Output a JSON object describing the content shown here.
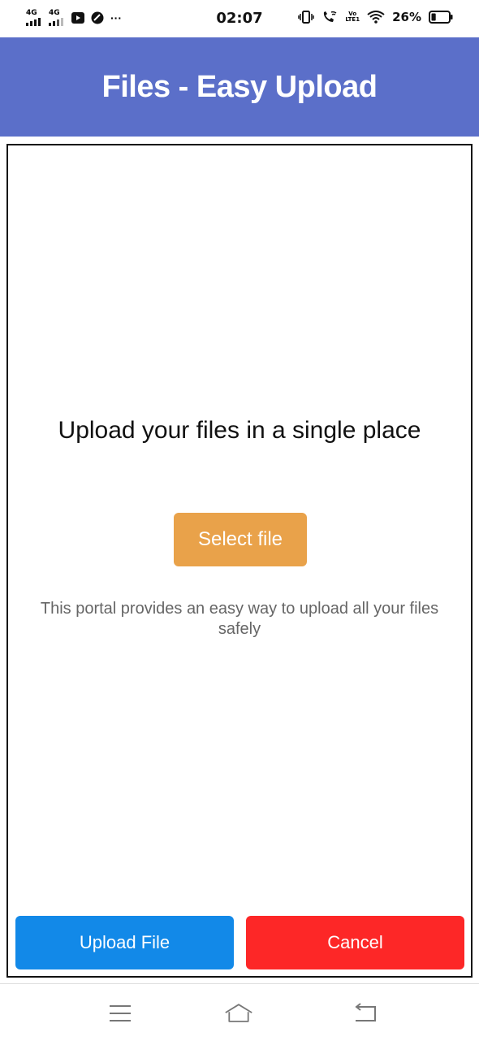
{
  "status_bar": {
    "network1": "4G",
    "network2": "4G",
    "volte_line1": "Vo",
    "volte_line2": "LTE1",
    "more": "···",
    "time": "02:07",
    "battery_percent": "26%",
    "battery_level": 0.26
  },
  "header": {
    "title": "Files - Easy Upload",
    "background_color": "#5b6fc9"
  },
  "main": {
    "headline": "Upload your files in a single place",
    "select_button": "Select file",
    "description": "This portal provides an easy way to upload all your files safely"
  },
  "footer": {
    "upload_button": "Upload File",
    "cancel_button": "Cancel"
  },
  "colors": {
    "select_button": "#e9a24a",
    "upload_button": "#1289e8",
    "cancel_button": "#fd2727"
  },
  "nav": {
    "icons": [
      "menu-icon",
      "home-icon",
      "back-icon"
    ]
  }
}
